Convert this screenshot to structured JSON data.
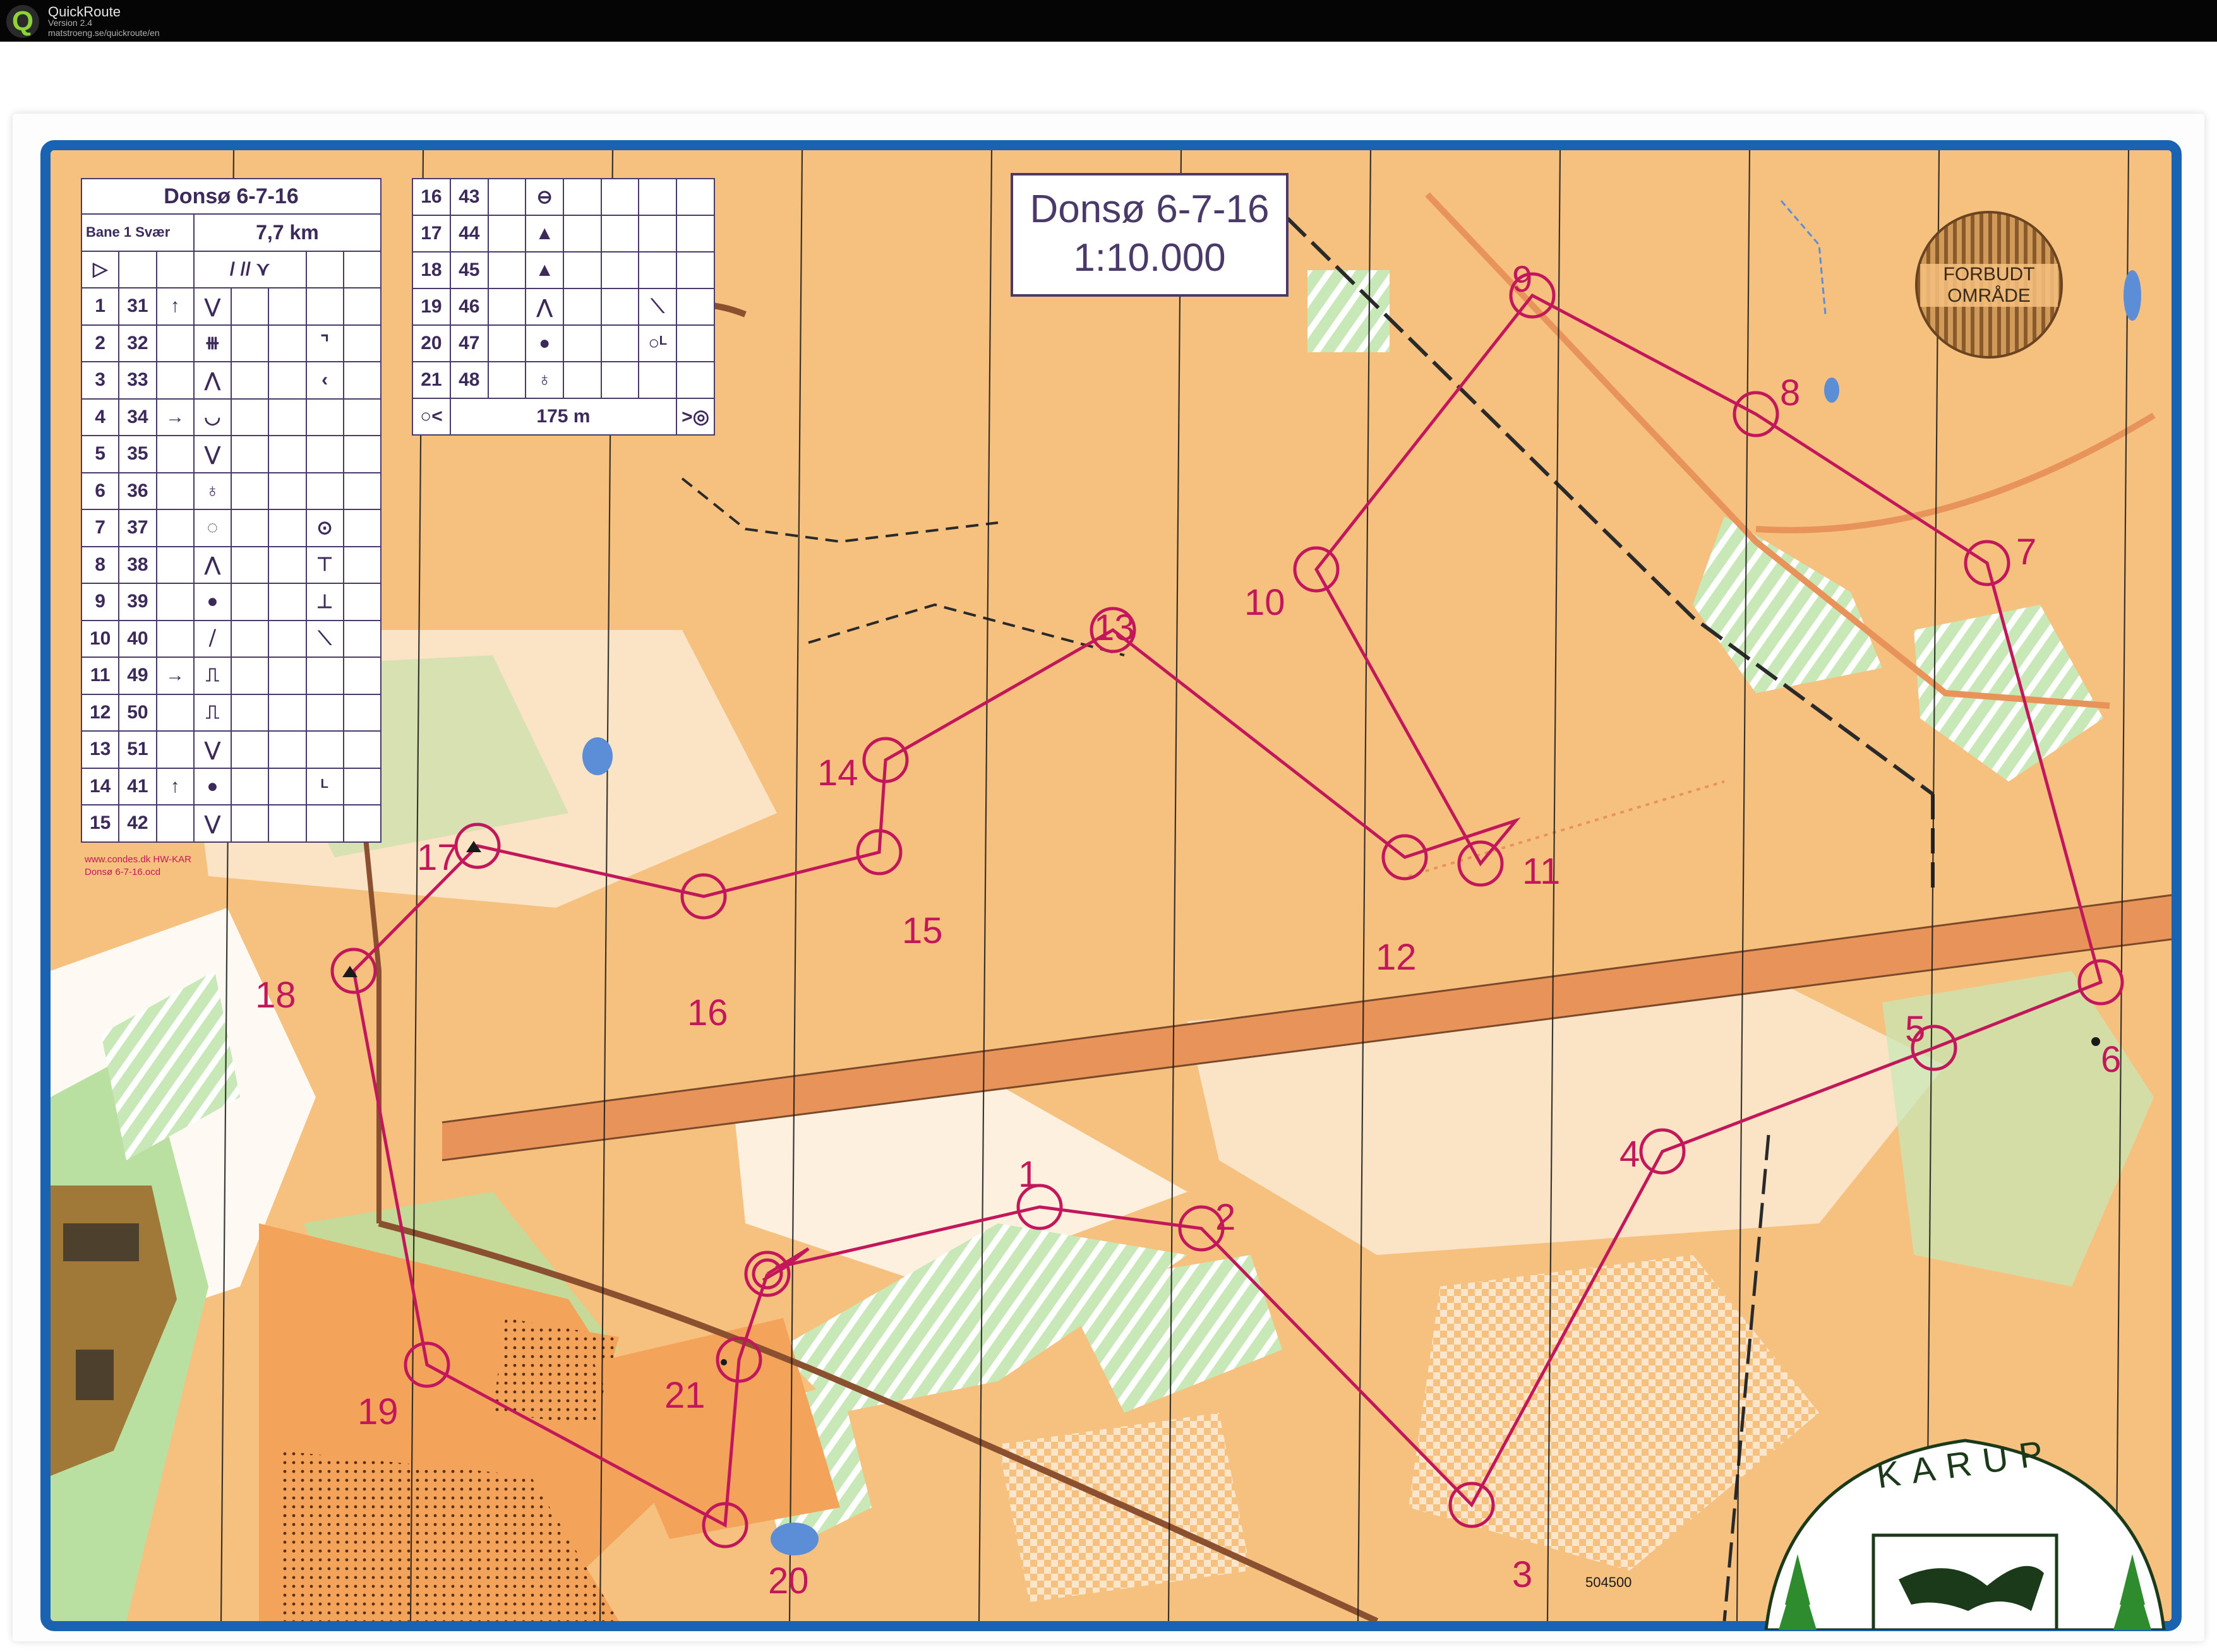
{
  "window": {
    "app_name": "QuickRoute",
    "version": "Version 2.4",
    "url": "matstroeng.se/quickroute/en"
  },
  "map_title": {
    "name": "Donsø 6-7-16",
    "scale": "1:10.000"
  },
  "forbidden_area": "FORBUDT OMRÅDE",
  "credit": [
    "www.condes.dk",
    "HW-KAR",
    "Donsø 6-7-16.ocd"
  ],
  "club_name": "KARUP",
  "grid_ref": "504500",
  "description_sheet": {
    "event": "Donsø 6-7-16",
    "course": "Bane 1 Svær",
    "length": "7,7 km",
    "start_symbol": "▷",
    "controls_left": [
      {
        "n": "1",
        "code": "31",
        "dir": "↑",
        "feature": "⋁",
        "extra": ""
      },
      {
        "n": "2",
        "code": "32",
        "dir": "",
        "feature": "⧻",
        "extra": "⌝"
      },
      {
        "n": "3",
        "code": "33",
        "dir": "",
        "feature": "⋀",
        "extra": "‹"
      },
      {
        "n": "4",
        "code": "34",
        "dir": "→",
        "feature": "◡",
        "extra": ""
      },
      {
        "n": "5",
        "code": "35",
        "dir": "",
        "feature": "⋁",
        "extra": ""
      },
      {
        "n": "6",
        "code": "36",
        "dir": "",
        "feature": "♁",
        "extra": ""
      },
      {
        "n": "7",
        "code": "37",
        "dir": "",
        "feature": "◌",
        "extra": "⊙"
      },
      {
        "n": "8",
        "code": "38",
        "dir": "",
        "feature": "⋀",
        "extra": "⊤"
      },
      {
        "n": "9",
        "code": "39",
        "dir": "",
        "feature": "●",
        "extra": "⊥"
      },
      {
        "n": "10",
        "code": "40",
        "dir": "",
        "feature": "⧸",
        "extra": "⟍"
      },
      {
        "n": "11",
        "code": "49",
        "dir": "→",
        "feature": "⎍",
        "extra": ""
      },
      {
        "n": "12",
        "code": "50",
        "dir": "",
        "feature": "⎍",
        "extra": ""
      },
      {
        "n": "13",
        "code": "51",
        "dir": "",
        "feature": "⋁",
        "extra": ""
      },
      {
        "n": "14",
        "code": "41",
        "dir": "↑",
        "feature": "●",
        "extra": "ᴸ"
      },
      {
        "n": "15",
        "code": "42",
        "dir": "",
        "feature": "⋁",
        "extra": ""
      }
    ],
    "controls_right": [
      {
        "n": "16",
        "code": "43",
        "dir": "",
        "feature": "⊖",
        "extra": ""
      },
      {
        "n": "17",
        "code": "44",
        "dir": "",
        "feature": "▲",
        "extra": ""
      },
      {
        "n": "18",
        "code": "45",
        "dir": "",
        "feature": "▲",
        "extra": ""
      },
      {
        "n": "19",
        "code": "46",
        "dir": "",
        "feature": "⋀",
        "extra": "⟍"
      },
      {
        "n": "20",
        "code": "47",
        "dir": "",
        "feature": "●",
        "extra": "○ᴸ"
      },
      {
        "n": "21",
        "code": "48",
        "dir": "",
        "feature": "♁",
        "extra": ""
      }
    ],
    "finish_row": {
      "from": "○<",
      "distance": "175 m",
      "to": ">◎"
    }
  },
  "control_labels": [
    "1",
    "2",
    "3",
    "4",
    "5",
    "6",
    "7",
    "8",
    "9",
    "10",
    "11",
    "12",
    "13",
    "14",
    "15",
    "16",
    "17",
    "18",
    "19",
    "20",
    "21"
  ],
  "colors": {
    "frame": "#1a63b3",
    "course": "#c2185b",
    "open_land": "#f6c17f",
    "forest": "#ffffff",
    "green": "#7fc47f",
    "road": "#e8935a",
    "water": "#5b8ed6"
  }
}
